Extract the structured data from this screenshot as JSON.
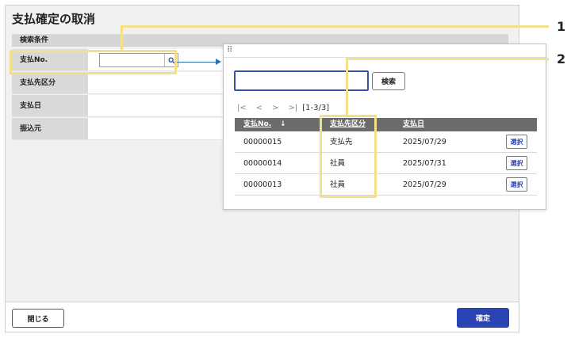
{
  "dialog": {
    "title": "支払確定の取消",
    "section_header": "検索条件",
    "fields": [
      {
        "label": "支払No."
      },
      {
        "label": "支払先区分"
      },
      {
        "label": "支払日"
      },
      {
        "label": "振込元"
      }
    ],
    "no_input_value": "",
    "close_label": "閉じる",
    "confirm_label": "確定"
  },
  "popup": {
    "search_value": "",
    "search_label": "検索",
    "pager": {
      "first": "|<",
      "prev": "<",
      "next": ">",
      "last": ">|",
      "info": "[1-3/3]"
    },
    "columns": [
      "支払No.",
      "支払先区分",
      "支払日"
    ],
    "sort_indicator": "↓",
    "rows": [
      {
        "no": "00000015",
        "kind": "支払先",
        "date": "2025/07/29",
        "action": "選択"
      },
      {
        "no": "00000014",
        "kind": "社員",
        "date": "2025/07/31",
        "action": "選択"
      },
      {
        "no": "00000013",
        "kind": "社員",
        "date": "2025/07/29",
        "action": "選択"
      }
    ]
  },
  "callouts": [
    "1",
    "2"
  ],
  "colors": {
    "accent": "#2a44b3",
    "highlight": "#f5e08a",
    "arrow": "#2b6fb5",
    "table_header": "#6b6b6b"
  }
}
